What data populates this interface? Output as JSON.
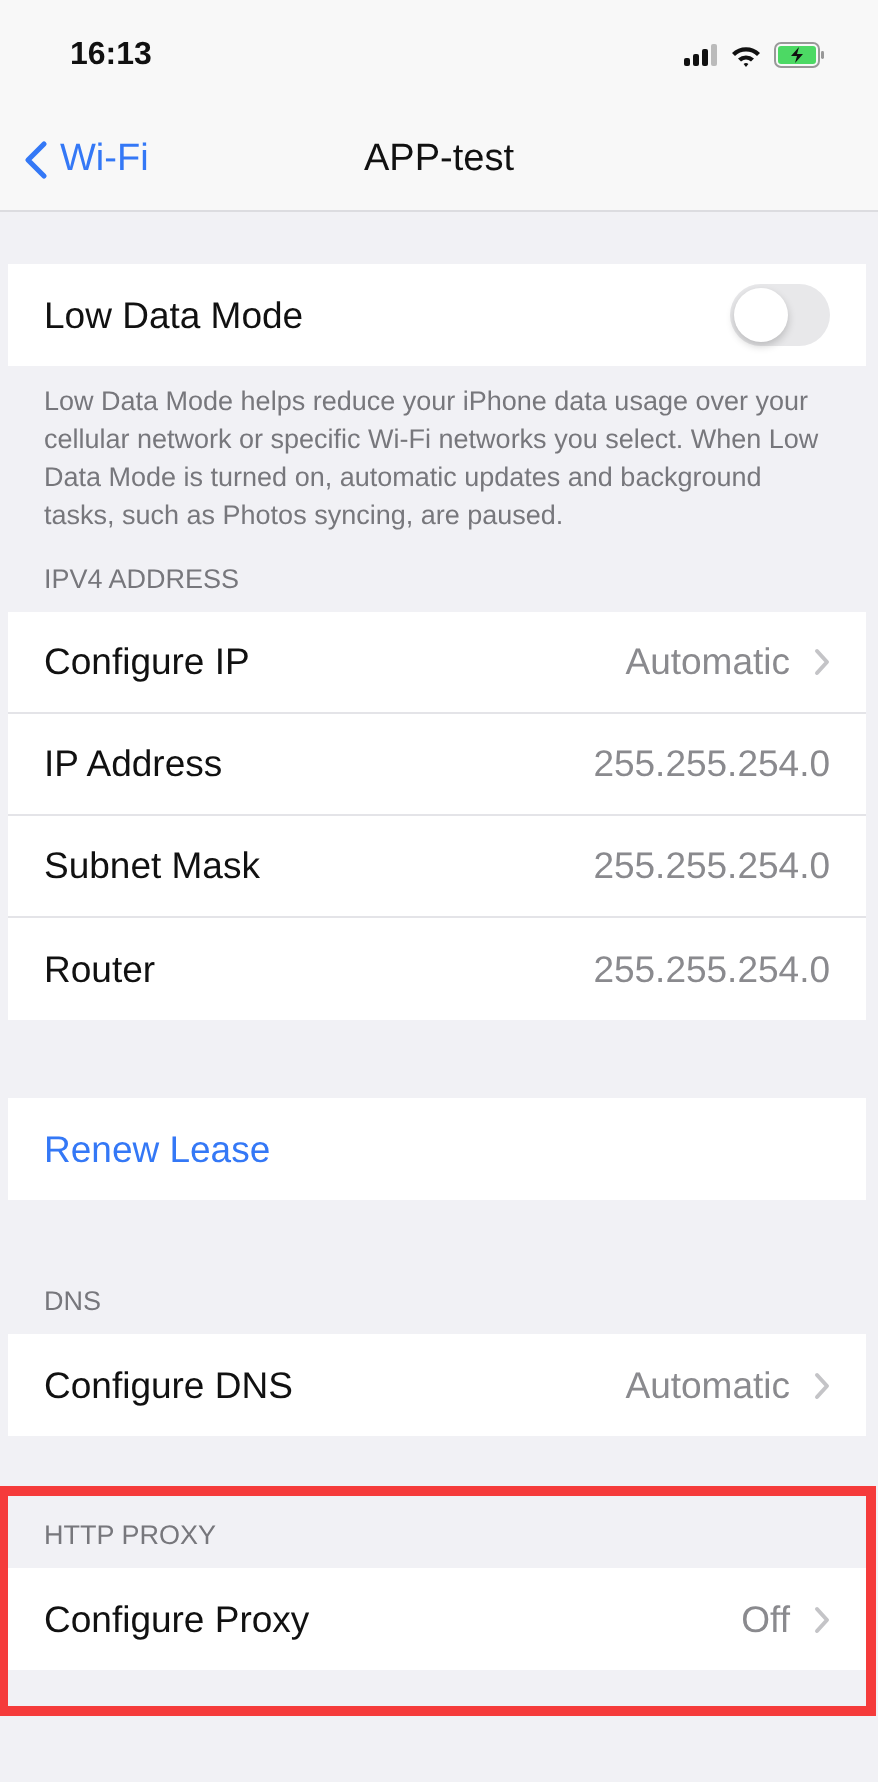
{
  "status_bar": {
    "time": "16:13"
  },
  "nav": {
    "back_label": "Wi-Fi",
    "title": "APP-test"
  },
  "sections": [
    {
      "highlighted": false,
      "rows": [
        {
          "kind": "toggle",
          "label": "Low Data Mode",
          "on": false
        }
      ],
      "footer": "Low Data Mode helps reduce your iPhone data usage over your cellular network or specific Wi-Fi networks you select. When Low Data Mode is turned on, automatic updates and background tasks, such as Photos syncing, are paused."
    },
    {
      "highlighted": false,
      "header": "IPV4 ADDRESS",
      "rows": [
        {
          "kind": "value",
          "label": "Configure IP",
          "value": "Automatic",
          "disclosure": true
        },
        {
          "kind": "value",
          "label": "IP Address",
          "value": "255.255.254.0",
          "disclosure": false
        },
        {
          "kind": "value",
          "label": "Subnet Mask",
          "value": "255.255.254.0",
          "disclosure": false
        },
        {
          "kind": "value",
          "label": "Router",
          "value": "255.255.254.0",
          "disclosure": false
        }
      ]
    },
    {
      "highlighted": false,
      "rows": [
        {
          "kind": "action",
          "label": "Renew Lease"
        }
      ]
    },
    {
      "highlighted": false,
      "header": "DNS",
      "rows": [
        {
          "kind": "value",
          "label": "Configure DNS",
          "value": "Automatic",
          "disclosure": true
        }
      ]
    },
    {
      "highlighted": true,
      "header": "HTTP PROXY",
      "rows": [
        {
          "kind": "value",
          "label": "Configure Proxy",
          "value": "Off",
          "disclosure": true
        }
      ]
    }
  ]
}
